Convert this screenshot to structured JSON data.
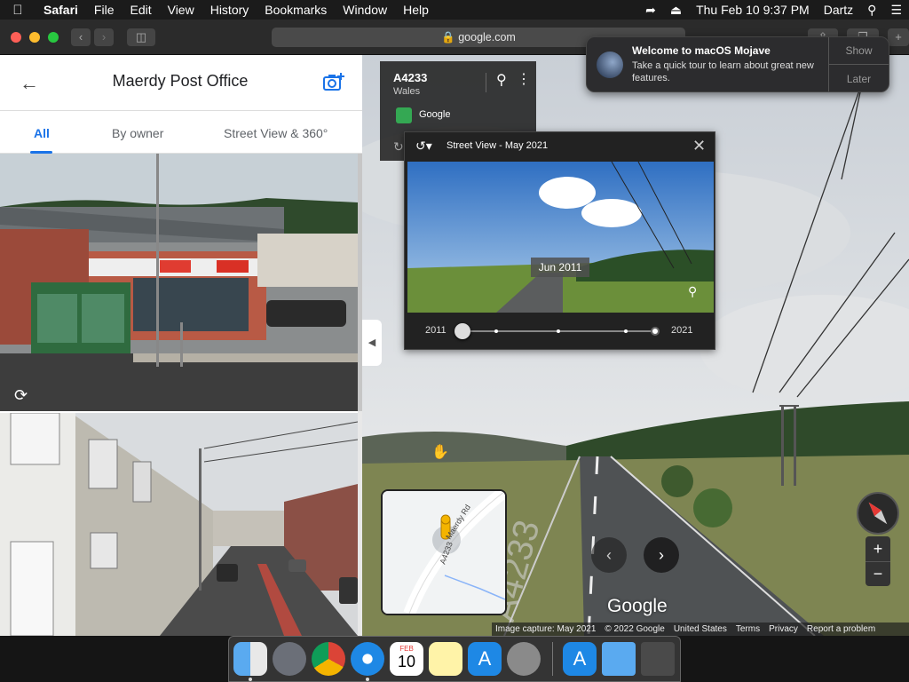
{
  "menubar": {
    "app_name": "Safari",
    "menus": [
      "File",
      "Edit",
      "View",
      "History",
      "Bookmarks",
      "Window",
      "Help"
    ],
    "datetime": "Thu Feb 10  9:37 PM",
    "user": "Dartz"
  },
  "toolbar": {
    "url": "google.com"
  },
  "side_panel": {
    "title": "Maerdy Post Office",
    "tabs": [
      {
        "label": "All",
        "active": true
      },
      {
        "label": "By owner",
        "active": false
      },
      {
        "label": "Street View & 360°",
        "active": false
      }
    ]
  },
  "address_card": {
    "road": "A4233",
    "region": "Wales",
    "source": "Google"
  },
  "time_panel": {
    "title": "Street View - May 2021",
    "hover_date": "Jun 2011",
    "year_start": "2011",
    "year_end": "2021",
    "selected_fraction": 0.0
  },
  "notification": {
    "title": "Welcome to macOS Mojave",
    "body": "Take a quick tour to learn about great new features.",
    "show_label": "Show",
    "later_label": "Later"
  },
  "minimap": {
    "road_label_1": "A4233",
    "road_label_2": "Maerdy Rd"
  },
  "street_view": {
    "logo": "Google",
    "road_marking": "A4233",
    "footer": [
      "Image capture: May 2021",
      "© 2022 Google",
      "United States",
      "Terms",
      "Privacy",
      "Report a problem"
    ]
  },
  "dock": {
    "calendar_month": "FEB",
    "calendar_day": "10",
    "apps": [
      "finder-icon",
      "launchpad-icon",
      "chrome-icon",
      "safari-icon",
      "calendar-icon",
      "notes-icon",
      "app-store-icon",
      "system-preferences-icon",
      "app-store-download-icon",
      "downloads-folder-icon",
      "trash-icon"
    ]
  },
  "colors": {
    "accent": "#1a73e8",
    "pin": "#f4b400"
  }
}
